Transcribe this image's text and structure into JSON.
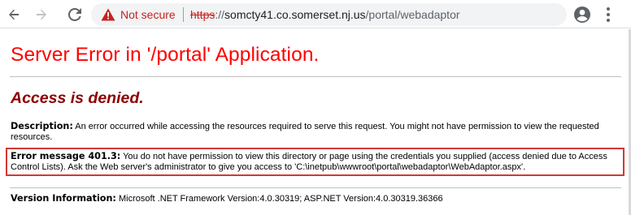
{
  "browser": {
    "security_label": "Not secure",
    "url_scheme": "https",
    "url_separator": "://",
    "url_host": "somcty41.co.somerset.nj.us",
    "url_path": "/portal/webadaptor",
    "colors": {
      "not_secure": "#c5221f",
      "omnibox_bg": "#f1f3f4",
      "icon": "#5f6368"
    },
    "icons": [
      "arrow-left-icon",
      "arrow-right-icon",
      "reload-icon",
      "warning-icon",
      "star-icon",
      "account-icon",
      "more-vertical-icon"
    ]
  },
  "page": {
    "title": "Server Error in '/portal' Application.",
    "subtitle": "Access is denied.",
    "description_label": "Description:",
    "description_text": " An error occurred while accessing the resources required to serve this request. You might not have permission to view the requested resources.",
    "error_label": "Error message 401.3:",
    "error_text": " You do not have permission to view this directory or page using the credentials you supplied (access denied due to Access Control Lists). Ask the Web server's administrator to give you access to 'C:\\inetpub\\wwwroot\\portal\\webadaptor\\WebAdaptor.aspx'.",
    "version_label": "Version Information:",
    "version_text": " Microsoft .NET Framework Version:4.0.30319; ASP.NET Version:4.0.30319.36366",
    "colors": {
      "title": "#ff0000",
      "subtitle": "#8b0000",
      "highlight_box": "#d03a34"
    }
  }
}
